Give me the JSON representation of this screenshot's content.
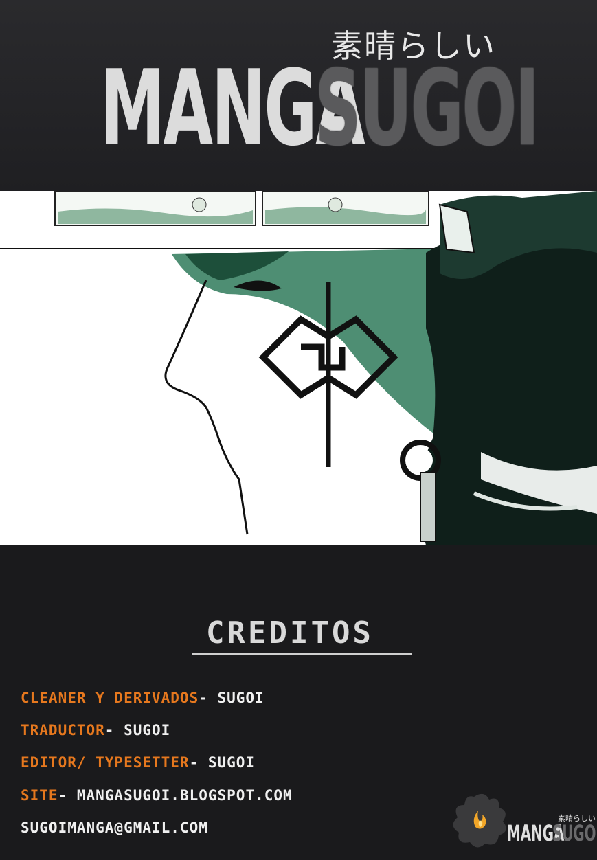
{
  "logo": {
    "japanese": "素晴らしい",
    "word1": "MANGA",
    "word2": "SUGOI"
  },
  "credits": {
    "title": "CREDITOS",
    "lines": [
      {
        "label": "CLEANER Y DERIVADOS",
        "value": "- SUGOI"
      },
      {
        "label": "TRADUCTOR",
        "value": "- SUGOI"
      },
      {
        "label": "EDITOR/ TYPESETTER",
        "value": "- SUGOI"
      },
      {
        "label": "SITE",
        "value": "- MANGASUGOI.BLOGSPOT.COM"
      },
      {
        "label": "",
        "value": "SUGOIMANGA@GMAIL.COM"
      }
    ]
  },
  "mini_logo": {
    "japanese": "素晴らしい",
    "word1": "MANGA",
    "word2": "SUGOI"
  },
  "colors": {
    "accent_orange": "#e6781e",
    "background_dark": "#1b1b1d",
    "art_green": "#2f7a5a"
  }
}
